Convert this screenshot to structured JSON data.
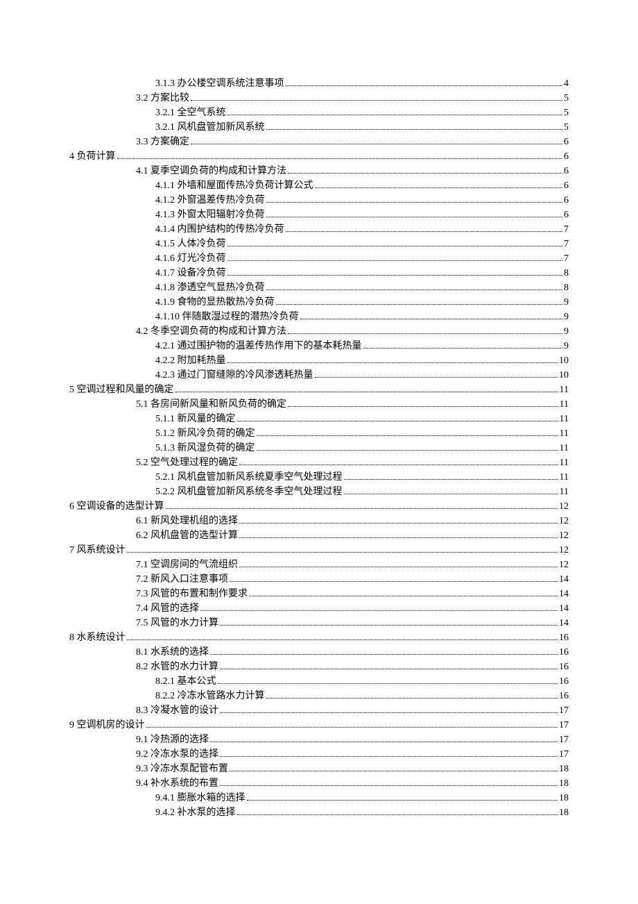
{
  "toc": [
    {
      "level": 3,
      "text": "3.1.3  办公楼空调系统注意事项",
      "page": "4"
    },
    {
      "level": 2,
      "text": "3.2  方案比较",
      "page": "5"
    },
    {
      "level": 3,
      "text": "3.2.1  全空气系统",
      "page": "5"
    },
    {
      "level": 3,
      "text": "3.2.1  风机盘管加新风系统",
      "page": "5"
    },
    {
      "level": 2,
      "text": "3.3  方案确定",
      "page": "6"
    },
    {
      "level": 1,
      "text": "4  负荷计算",
      "page": "6"
    },
    {
      "level": 2,
      "text": "4.1  夏季空调负荷的构成和计算方法",
      "page": "6"
    },
    {
      "level": 3,
      "text": "4.1.1  外墙和屋面传热冷负荷计算公式",
      "page": "6"
    },
    {
      "level": 3,
      "text": "4.1.2  外窗温差传热冷负荷",
      "page": "6"
    },
    {
      "level": 3,
      "text": "4.1.3  外窗太阳辐射冷负荷",
      "page": "6"
    },
    {
      "level": 3,
      "text": "4.1.4  内围护结构的传热冷负荷",
      "page": "7"
    },
    {
      "level": 3,
      "text": "4.1.5  人体冷负荷",
      "page": "7"
    },
    {
      "level": 3,
      "text": "4.1.6  灯光冷负荷",
      "page": "7"
    },
    {
      "level": 3,
      "text": "4.1.7  设备冷负荷",
      "page": "8"
    },
    {
      "level": 3,
      "text": "4.1.8  渗透空气显热冷负荷",
      "page": "8"
    },
    {
      "level": 3,
      "text": "4.1.9  食物的显热散热冷负荷",
      "page": "9"
    },
    {
      "level": 3,
      "text": "4.1.10  伴随散湿过程的潜热冷负荷",
      "page": "9"
    },
    {
      "level": 2,
      "text": "4.2  冬季空调负荷的构成和计算方法",
      "page": "9"
    },
    {
      "level": 3,
      "text": "4.2.1  通过围护物的温差传热作用下的基本耗热量",
      "page": "9"
    },
    {
      "level": 3,
      "text": "4.2.2  附加耗热量",
      "page": "10"
    },
    {
      "level": 3,
      "text": "4.2.3  通过门窗缝隙的冷风渗透耗热量",
      "page": "10"
    },
    {
      "level": 1,
      "text": "5  空调过程和风量的确定",
      "page": "11"
    },
    {
      "level": 2,
      "text": "5.1  各房间新风量和新风负荷的确定",
      "page": "11"
    },
    {
      "level": 3,
      "text": "5.1.1  新风量的确定",
      "page": "11"
    },
    {
      "level": 3,
      "text": "5.1.2  新风冷负荷的确定",
      "page": "11"
    },
    {
      "level": 3,
      "text": "5.1.3  新风湿负荷的确定",
      "page": "11"
    },
    {
      "level": 2,
      "text": "5.2  空气处理过程的确定",
      "page": "11"
    },
    {
      "level": 3,
      "text": "5.2.1  风机盘管加新风系统夏季空气处理过程",
      "page": "11"
    },
    {
      "level": 3,
      "text": "5.2.2  风机盘管加新风系统冬季空气处理过程",
      "page": "11"
    },
    {
      "level": 1,
      "text": "6  空调设备的选型计算",
      "page": "12"
    },
    {
      "level": 2,
      "text": "6.1  新风处理机组的选择",
      "page": "12"
    },
    {
      "level": 2,
      "text": "6.2  风机盘管的选型计算",
      "page": "12"
    },
    {
      "level": 1,
      "text": "7  风系统设计",
      "page": "12"
    },
    {
      "level": 2,
      "text": "7.1  空调房间的气流组织",
      "page": "12"
    },
    {
      "level": 2,
      "text": "7.2  新风入口注意事项",
      "page": "14"
    },
    {
      "level": 2,
      "text": "7.3  风管的布置和制作要求",
      "page": "14"
    },
    {
      "level": 2,
      "text": "7.4  风管的选择",
      "page": "14"
    },
    {
      "level": 2,
      "text": "7.5  风管的水力计算",
      "page": "14"
    },
    {
      "level": 1,
      "text": "8  水系统设计",
      "page": "16"
    },
    {
      "level": 2,
      "text": "8.1  水系统的选择",
      "page": "16"
    },
    {
      "level": 2,
      "text": "8.2  水管的水力计算",
      "page": "16"
    },
    {
      "level": 3,
      "text": "8.2.1  基本公式",
      "page": "16"
    },
    {
      "level": 3,
      "text": "8.2.2  冷冻水管路水力计算",
      "page": "16"
    },
    {
      "level": 2,
      "text": "8.3  冷凝水管的设计",
      "page": "17"
    },
    {
      "level": 1,
      "text": "9  空调机房的设计",
      "page": "17"
    },
    {
      "level": 2,
      "text": "9.1  冷热源的选择",
      "page": "17"
    },
    {
      "level": 2,
      "text": "9.2  冷冻水泵的选择",
      "page": "17"
    },
    {
      "level": 2,
      "text": "9.3  冷冻水泵配管布置",
      "page": "18"
    },
    {
      "level": 2,
      "text": "9.4  补水系统的布置",
      "page": "18"
    },
    {
      "level": 3,
      "text": "9.4.1  膨胀水箱的选择",
      "page": "18"
    },
    {
      "level": 3,
      "text": "9.4.2  补水泵的选择",
      "page": "18"
    }
  ]
}
